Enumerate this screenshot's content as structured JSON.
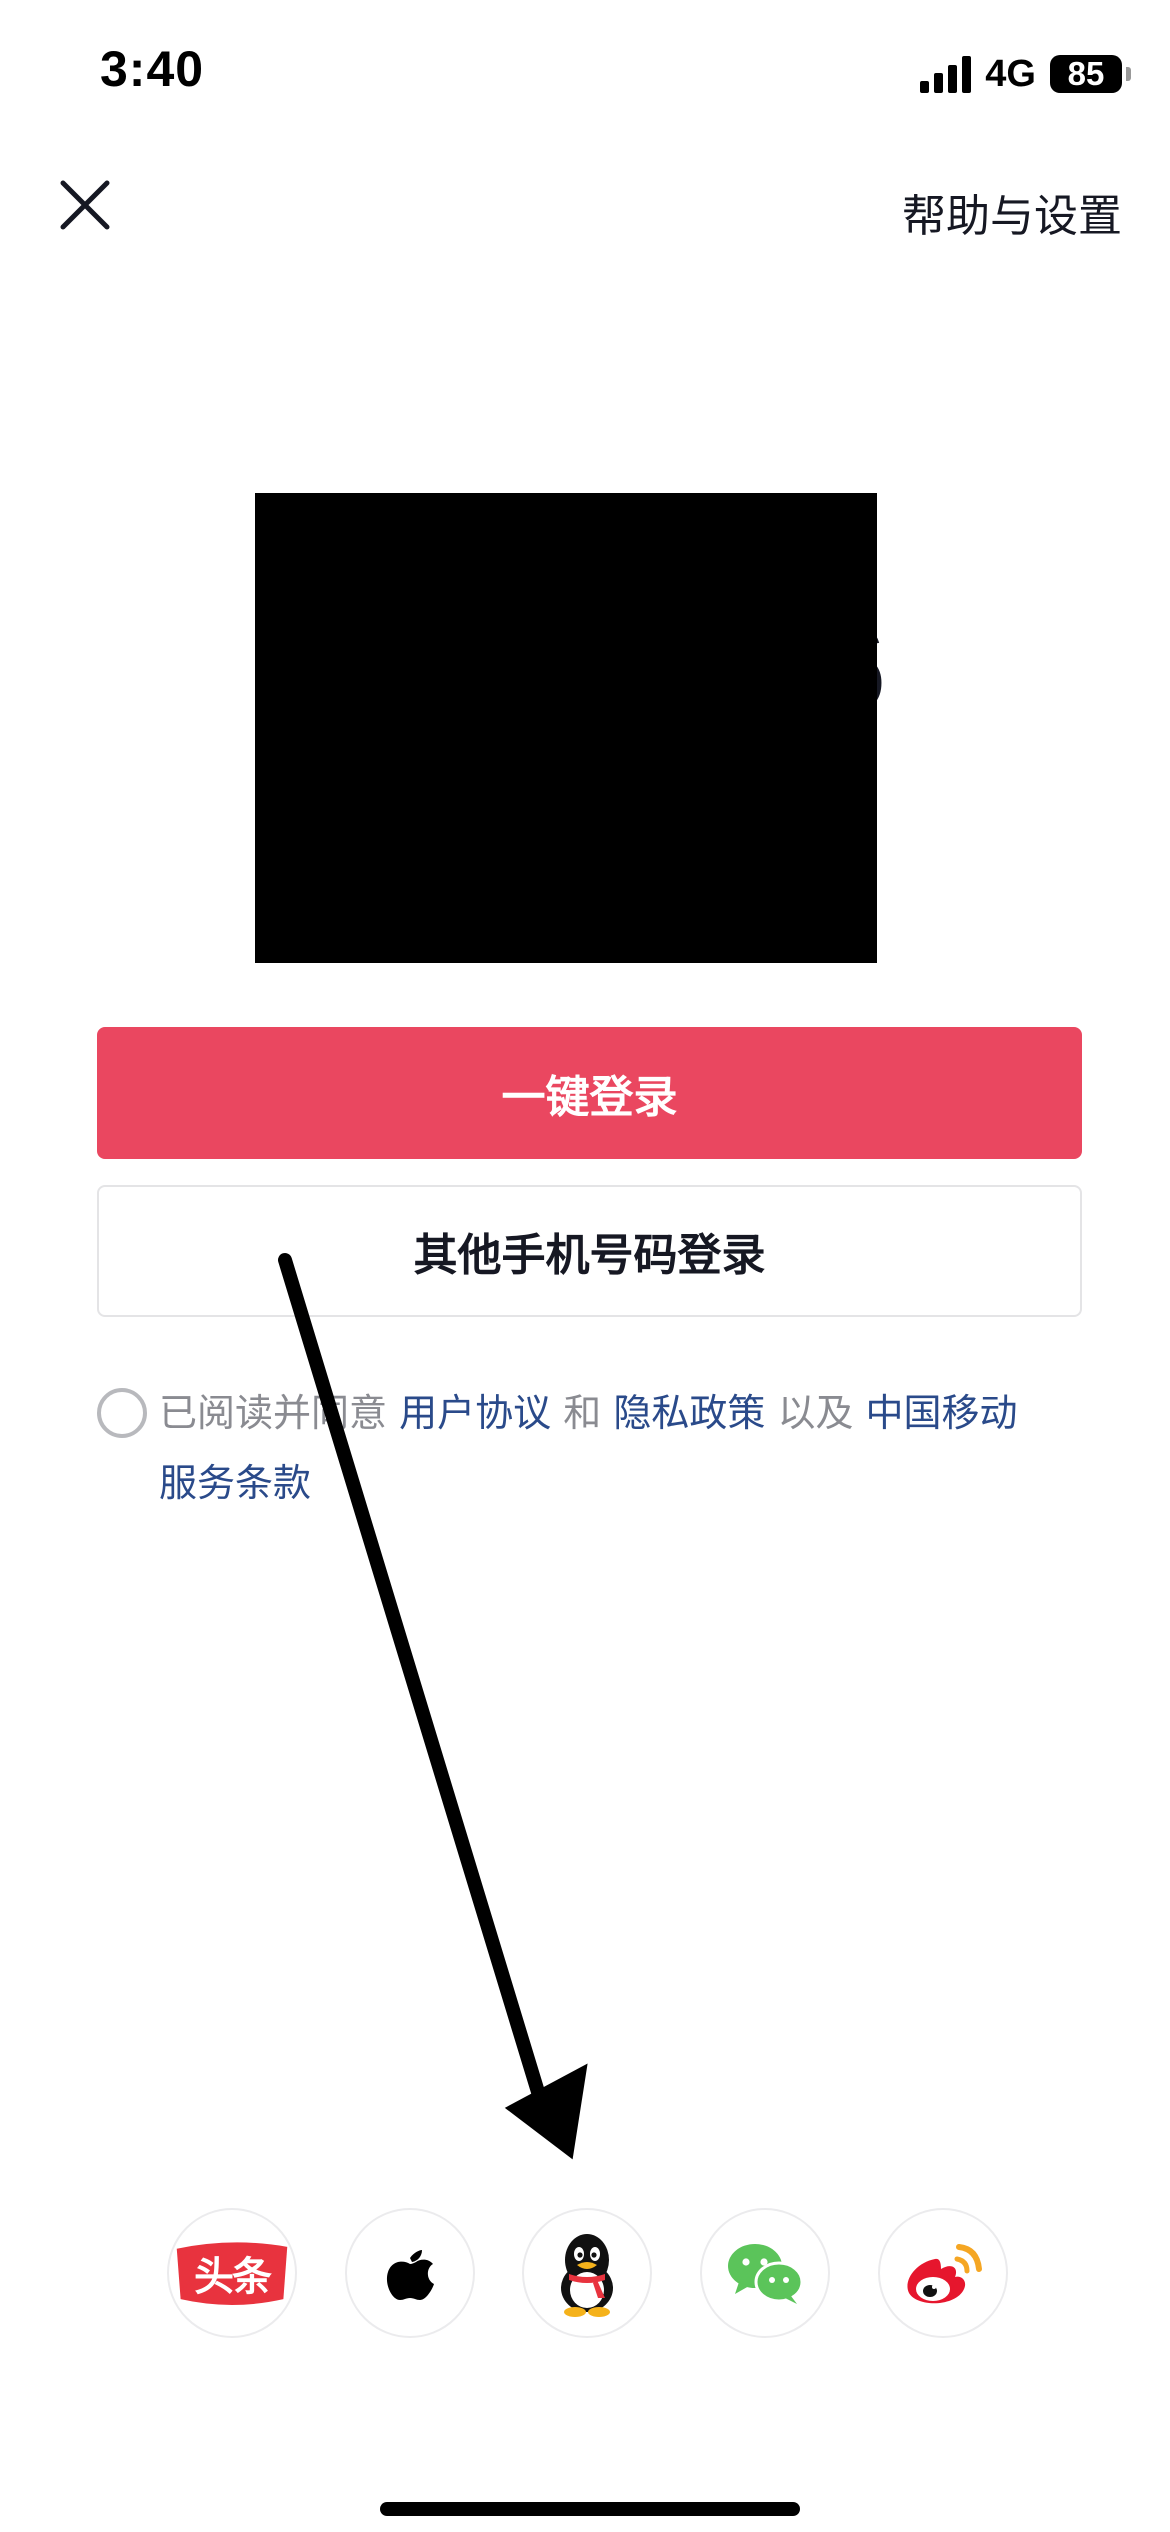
{
  "status_bar": {
    "time": "3:40",
    "network": "4G",
    "battery": "85"
  },
  "header": {
    "help_label": "帮助与设置",
    "close_icon": "close-icon"
  },
  "masked_phone_fragment": "6",
  "buttons": {
    "one_tap_login": "一键登录",
    "other_phone_login": "其他手机号码登录"
  },
  "agreement": {
    "prefix": "已阅读并同意",
    "user_agreement": "用户协议",
    "and": "和",
    "privacy_policy": "隐私政策",
    "as_well_as": "以及",
    "carrier_terms_line1": "中国移动",
    "carrier_terms_line2": "服务条款"
  },
  "social_logins": [
    {
      "name": "toutiao-icon",
      "label": "头条"
    },
    {
      "name": "apple-icon"
    },
    {
      "name": "qq-icon"
    },
    {
      "name": "wechat-icon"
    },
    {
      "name": "weibo-icon"
    }
  ],
  "colors": {
    "primary": "#ea4760",
    "link": "#2a4a8a",
    "muted_text": "#8a8b91",
    "toutiao_red": "#e8333e",
    "wechat_green": "#5bc45a",
    "weibo_red": "#e6162d",
    "weibo_orange": "#f5a623"
  }
}
